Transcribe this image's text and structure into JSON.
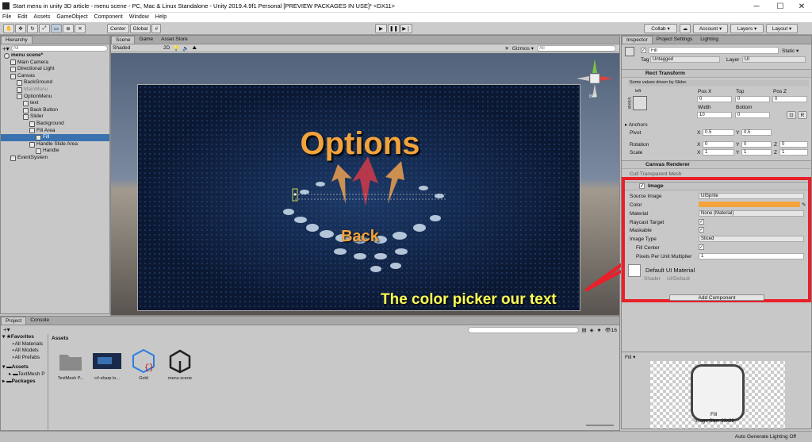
{
  "window": {
    "title": "Start menu in unity 3D article - menu scene - PC, Mac & Linux Standalone - Unity 2019.4.9f1 Personal [PREVIEW PACKAGES IN USE]* <DX11>",
    "minimize": "─",
    "maximize": "☐",
    "close": "✕"
  },
  "menu": [
    "File",
    "Edit",
    "Assets",
    "GameObject",
    "Component",
    "Window",
    "Help"
  ],
  "toolbar": {
    "center": "Center",
    "global": "Global",
    "collab": "Collab ▾",
    "account": "Account ▾",
    "layers": "Layers ▾",
    "layout": "Layout ▾"
  },
  "hierarchy": {
    "tab": "Hierarchy",
    "search_placeholder": "All",
    "items": [
      {
        "label": "menu scene*",
        "depth": 0,
        "bold": true
      },
      {
        "label": "Main Camera",
        "depth": 1
      },
      {
        "label": "Directional Light",
        "depth": 1
      },
      {
        "label": "Canvas",
        "depth": 1
      },
      {
        "label": "BackGround",
        "depth": 2
      },
      {
        "label": "MainMenu",
        "depth": 2,
        "dim": true
      },
      {
        "label": "OptionMenu",
        "depth": 2
      },
      {
        "label": "text",
        "depth": 3
      },
      {
        "label": "Back Button",
        "depth": 3
      },
      {
        "label": "Slider",
        "depth": 3
      },
      {
        "label": "Background",
        "depth": 4
      },
      {
        "label": "Fill Area",
        "depth": 4
      },
      {
        "label": "Fill",
        "depth": 5,
        "selected": true
      },
      {
        "label": "Handle Slide Area",
        "depth": 4
      },
      {
        "label": "Handle",
        "depth": 5
      },
      {
        "label": "EventSystem",
        "depth": 1
      }
    ]
  },
  "scene": {
    "tabs": [
      "Scene",
      "Game",
      "Asset Store"
    ],
    "shading": "Shaded",
    "mode2d": "2D",
    "gizmos": "Gizmos ▾",
    "search": "All",
    "iso": "Iso",
    "options_text": "Options",
    "back_text": "Back"
  },
  "annotation": "The color picker our text",
  "project": {
    "tabs": [
      "Project",
      "Console"
    ],
    "favorites": "Favorites",
    "fav_items": [
      "All Materials",
      "All Models",
      "All Prefabs"
    ],
    "assets_root": "Assets",
    "assets_children": [
      "TextMesh P"
    ],
    "packages": "Packages",
    "breadcrumb": "Assets",
    "count": "16",
    "assets": [
      {
        "name": "TextMesh P...",
        "type": "folder"
      },
      {
        "name": "c#-sharp lo...",
        "type": "image"
      },
      {
        "name": "Gold",
        "type": "prefab"
      },
      {
        "name": "menu scene",
        "type": "unity"
      }
    ]
  },
  "inspector": {
    "tabs": [
      "Inspector",
      "Project Settings",
      "Lighting"
    ],
    "name": "Fill",
    "static": "Static ▾",
    "tag_label": "Tag",
    "tag": "Untagged",
    "layer_label": "Layer",
    "layer": "UI",
    "rect": {
      "title": "Rect Transform",
      "note": "Some values driven by Slider.",
      "anchor_preset": "left",
      "stretch": "stretch",
      "posx_l": "Pos X",
      "top_l": "Top",
      "posz_l": "Pos Z",
      "posx": "0",
      "top": "0",
      "posz": "0",
      "width_l": "Width",
      "bottom_l": "Bottom",
      "width": "10",
      "bottom": "0",
      "anchors": "Anchors",
      "pivot_l": "Pivot",
      "pivot_x": "0.5",
      "pivot_y": "0.5",
      "rotation_l": "Rotation",
      "rot": [
        "0",
        "0",
        "0"
      ],
      "scale_l": "Scale",
      "scale": [
        "1",
        "1",
        "1"
      ],
      "r": "R"
    },
    "canvas_renderer": "Canvas Renderer",
    "cull": "Cull Transparent Mesh",
    "image": {
      "title": "Image",
      "source_l": "Source Image",
      "source": "UISprite",
      "color_l": "Color",
      "color": "#f4a33c",
      "material_l": "Material",
      "material": "None (Material)",
      "raycast_l": "Raycast Target",
      "maskable_l": "Maskable",
      "type_l": "Image Type",
      "type": "Sliced",
      "fill_center_l": "Fill Center",
      "ppu_l": "Pixels Per Unit Multiplier",
      "ppu": "1"
    },
    "material": {
      "name": "Default UI Material",
      "shader_l": "Shader",
      "shader": "UI/Default"
    },
    "add_component": "Add Component",
    "preview_title": "Fill ▾",
    "preview_caption": "Fill",
    "preview_info": "Image Size: 32x32"
  },
  "status": "Auto Generate Lighting Off",
  "colors": {
    "annotation": "#e8202a",
    "options_text": "#f2a33c",
    "highlight": "#ffff55"
  }
}
